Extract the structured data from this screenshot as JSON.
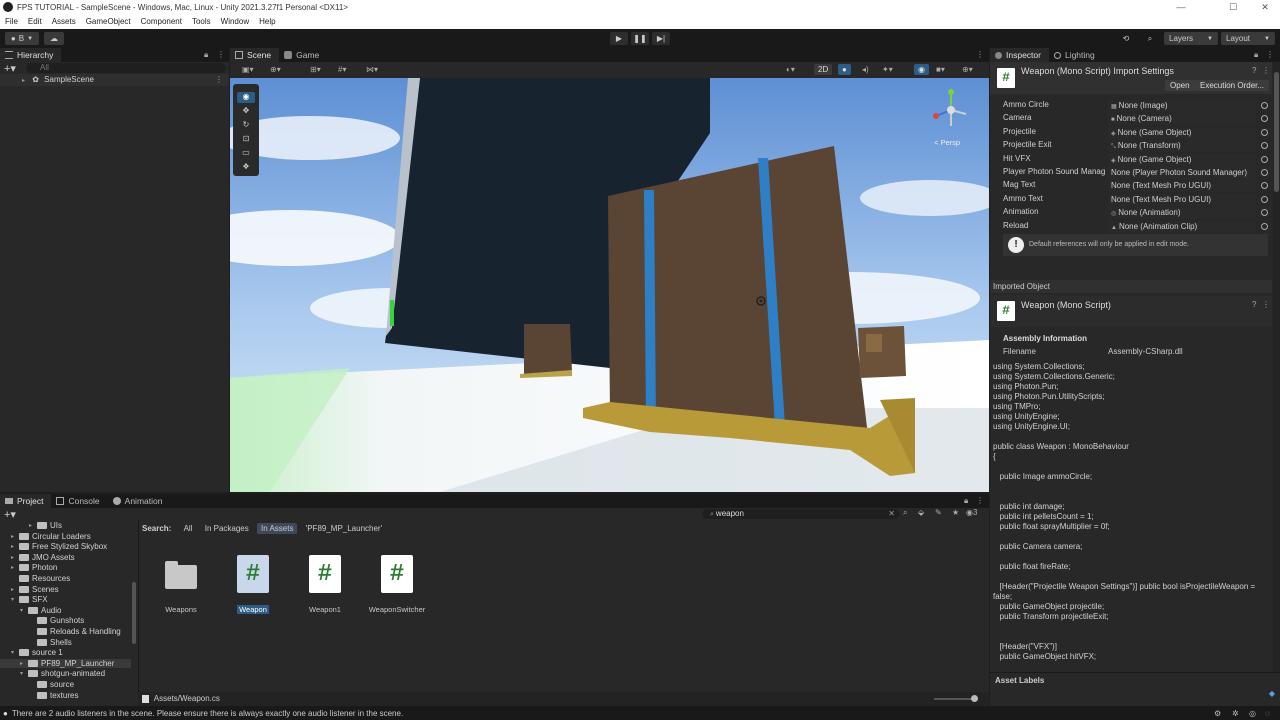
{
  "window": {
    "title": "FPS TUTORIAL - SampleScene - Windows, Mac, Linux - Unity 2021.3.27f1 Personal <DX11>"
  },
  "menu": [
    "File",
    "Edit",
    "Assets",
    "GameObject",
    "Component",
    "Tools",
    "Window",
    "Help"
  ],
  "toolbar": {
    "account_label": "B",
    "layers_label": "Layers",
    "layout_label": "Layout"
  },
  "hierarchy": {
    "tab_label": "Hierarchy",
    "search_placeholder": "All",
    "scene_name": "SampleScene"
  },
  "scene": {
    "tabs": [
      "Scene",
      "Game"
    ],
    "mode_2d": "2D",
    "persp_label": "< Persp"
  },
  "inspector": {
    "tabs": [
      "Inspector",
      "Lighting"
    ],
    "header_title": "Weapon (Mono Script) Import Settings",
    "open_button": "Open",
    "execution_order_button": "Execution Order...",
    "fields": [
      {
        "label": "Ammo Circle",
        "value": "None (Image)"
      },
      {
        "label": "Camera",
        "value": "None (Camera)"
      },
      {
        "label": "Projectile",
        "value": "None (Game Object)"
      },
      {
        "label": "Projectile Exit",
        "value": "None (Transform)"
      },
      {
        "label": "Hit VFX",
        "value": "None (Game Object)"
      },
      {
        "label": "Player Photon Sound Manag",
        "value": "None (Player Photon Sound Manager)"
      },
      {
        "label": "Mag Text",
        "value": "None (Text Mesh Pro UGUI)"
      },
      {
        "label": "Ammo Text",
        "value": "None (Text Mesh Pro UGUI)"
      },
      {
        "label": "Animation",
        "value": "None (Animation)"
      },
      {
        "label": "Reload",
        "value": "None (Animation Clip)"
      }
    ],
    "info_message": "Default references will only be applied in edit mode.",
    "imported_object_label": "Imported Object",
    "imported_title": "Weapon (Mono Script)",
    "assembly_info_label": "Assembly Information",
    "filename_label": "Filename",
    "filename_value": "Assembly-CSharp.dll",
    "code": "using System.Collections;\nusing System.Collections.Generic;\nusing Photon.Pun;\nusing Photon.Pun.UtilityScripts;\nusing TMPro;\nusing UnityEngine;\nusing UnityEngine.UI;\n\npublic class Weapon : MonoBehaviour\n{\n\n   public Image ammoCircle;\n\n\n   public int damage;\n   public int pelletsCount = 1;\n   public float sprayMultiplier = 0f;\n\n   public Camera camera;\n\n   public float fireRate;\n\n   [Header(\"Projectile Weapon Settings\")] public bool isProjectileWeapon =\nfalse;\n   public GameObject projectile;\n   public Transform projectileExit;\n\n\n   [Header(\"VFX\")]\n   public GameObject hitVFX;",
    "asset_labels": "Asset Labels"
  },
  "project": {
    "tabs": [
      "Project",
      "Console",
      "Animation"
    ],
    "search_value": "weapon",
    "search_label": "Search:",
    "filters": [
      "All",
      "In Packages",
      "In Assets",
      "'PF89_MP_Launcher'"
    ],
    "hidden_count": "3",
    "tree": [
      {
        "label": "UIs",
        "indent": 3,
        "arrow": "▸"
      },
      {
        "label": "Circular Loaders",
        "indent": 1,
        "arrow": "▸"
      },
      {
        "label": "Free Stylized Skybox",
        "indent": 1,
        "arrow": "▸"
      },
      {
        "label": "JMO Assets",
        "indent": 1,
        "arrow": "▸"
      },
      {
        "label": "Photon",
        "indent": 1,
        "arrow": "▸"
      },
      {
        "label": "Resources",
        "indent": 1,
        "arrow": ""
      },
      {
        "label": "Scenes",
        "indent": 1,
        "arrow": "▸"
      },
      {
        "label": "SFX",
        "indent": 1,
        "arrow": "▾"
      },
      {
        "label": "Audio",
        "indent": 2,
        "arrow": "▾"
      },
      {
        "label": "Gunshots",
        "indent": 3,
        "arrow": ""
      },
      {
        "label": "Reloads & Handling",
        "indent": 3,
        "arrow": ""
      },
      {
        "label": "Shells",
        "indent": 3,
        "arrow": ""
      },
      {
        "label": "source 1",
        "indent": 1,
        "arrow": "▾"
      },
      {
        "label": "PF89_MP_Launcher",
        "indent": 2,
        "arrow": "▸"
      },
      {
        "label": "shotgun-animated",
        "indent": 2,
        "arrow": "▾"
      },
      {
        "label": "source",
        "indent": 3,
        "arrow": ""
      },
      {
        "label": "textures",
        "indent": 3,
        "arrow": ""
      }
    ],
    "assets": [
      {
        "name": "Weapons",
        "kind": "folder"
      },
      {
        "name": "Weapon",
        "kind": "script"
      },
      {
        "name": "Weapon1",
        "kind": "script"
      },
      {
        "name": "WeaponSwitcher",
        "kind": "script"
      }
    ],
    "selected_path": "Assets/Weapon.cs"
  },
  "status": {
    "message": "There are 2 audio listeners in the scene. Please ensure there is always exactly one audio listener in the scene."
  },
  "colors": {
    "accent_blue": "#2c5d87",
    "script_green": "#2e7d32"
  }
}
